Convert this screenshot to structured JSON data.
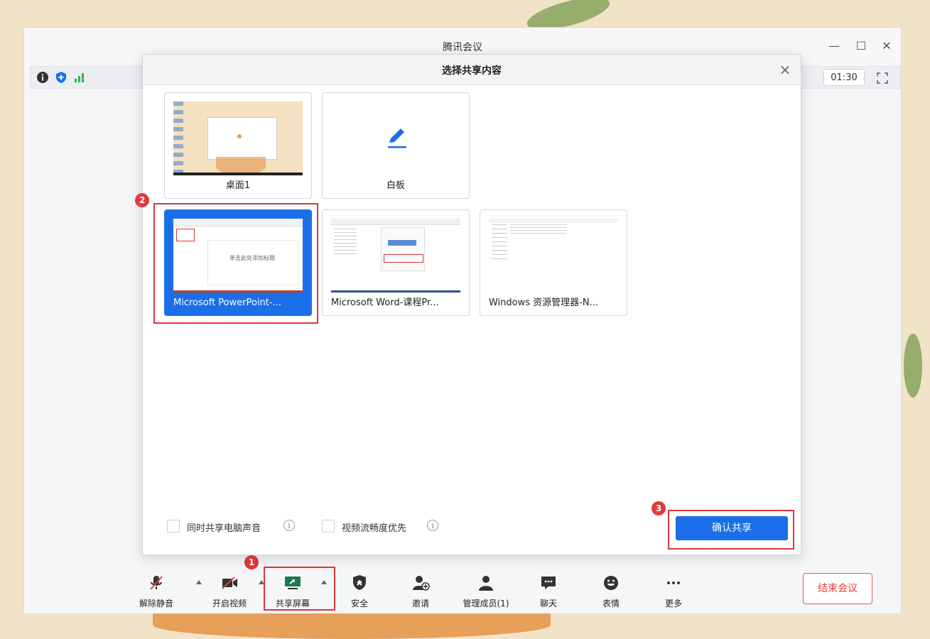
{
  "app": {
    "title": "腾讯会议",
    "timer": "01:30"
  },
  "dialog": {
    "title": "选择共享内容",
    "cards_row1": [
      {
        "label": "桌面1",
        "icon": "desktop-thumbnail"
      },
      {
        "label": "白板",
        "icon": "pen-icon"
      }
    ],
    "cards_row2": [
      {
        "label": "Microsoft PowerPoint-...",
        "selected": true,
        "thumb_text": "单击此处添加标题"
      },
      {
        "label": "Microsoft Word-课程Pr..."
      },
      {
        "label": "Windows 资源管理器-N..."
      }
    ],
    "options": {
      "share_audio": "同时共享电脑声音",
      "video_priority": "视频流畅度优先"
    },
    "confirm_label": "确认共享"
  },
  "toolbar": {
    "items": [
      {
        "label": "解除静音",
        "icon": "mic-muted-icon"
      },
      {
        "label": "开启视频",
        "icon": "video-off-icon"
      },
      {
        "label": "共享屏幕",
        "icon": "share-screen-icon"
      },
      {
        "label": "安全",
        "icon": "shield-icon"
      },
      {
        "label": "邀请",
        "icon": "invite-icon"
      },
      {
        "label": "管理成员(1)",
        "icon": "members-icon"
      },
      {
        "label": "聊天",
        "icon": "chat-icon"
      },
      {
        "label": "表情",
        "icon": "emoji-icon"
      },
      {
        "label": "更多",
        "icon": "more-icon"
      }
    ],
    "end_label": "结束会议"
  },
  "annotations": {
    "step1": "1",
    "step2": "2",
    "step3": "3"
  },
  "colors": {
    "accent": "#1a6fe8",
    "annotation_red": "#d9363e",
    "end_red": "#e0403a"
  }
}
